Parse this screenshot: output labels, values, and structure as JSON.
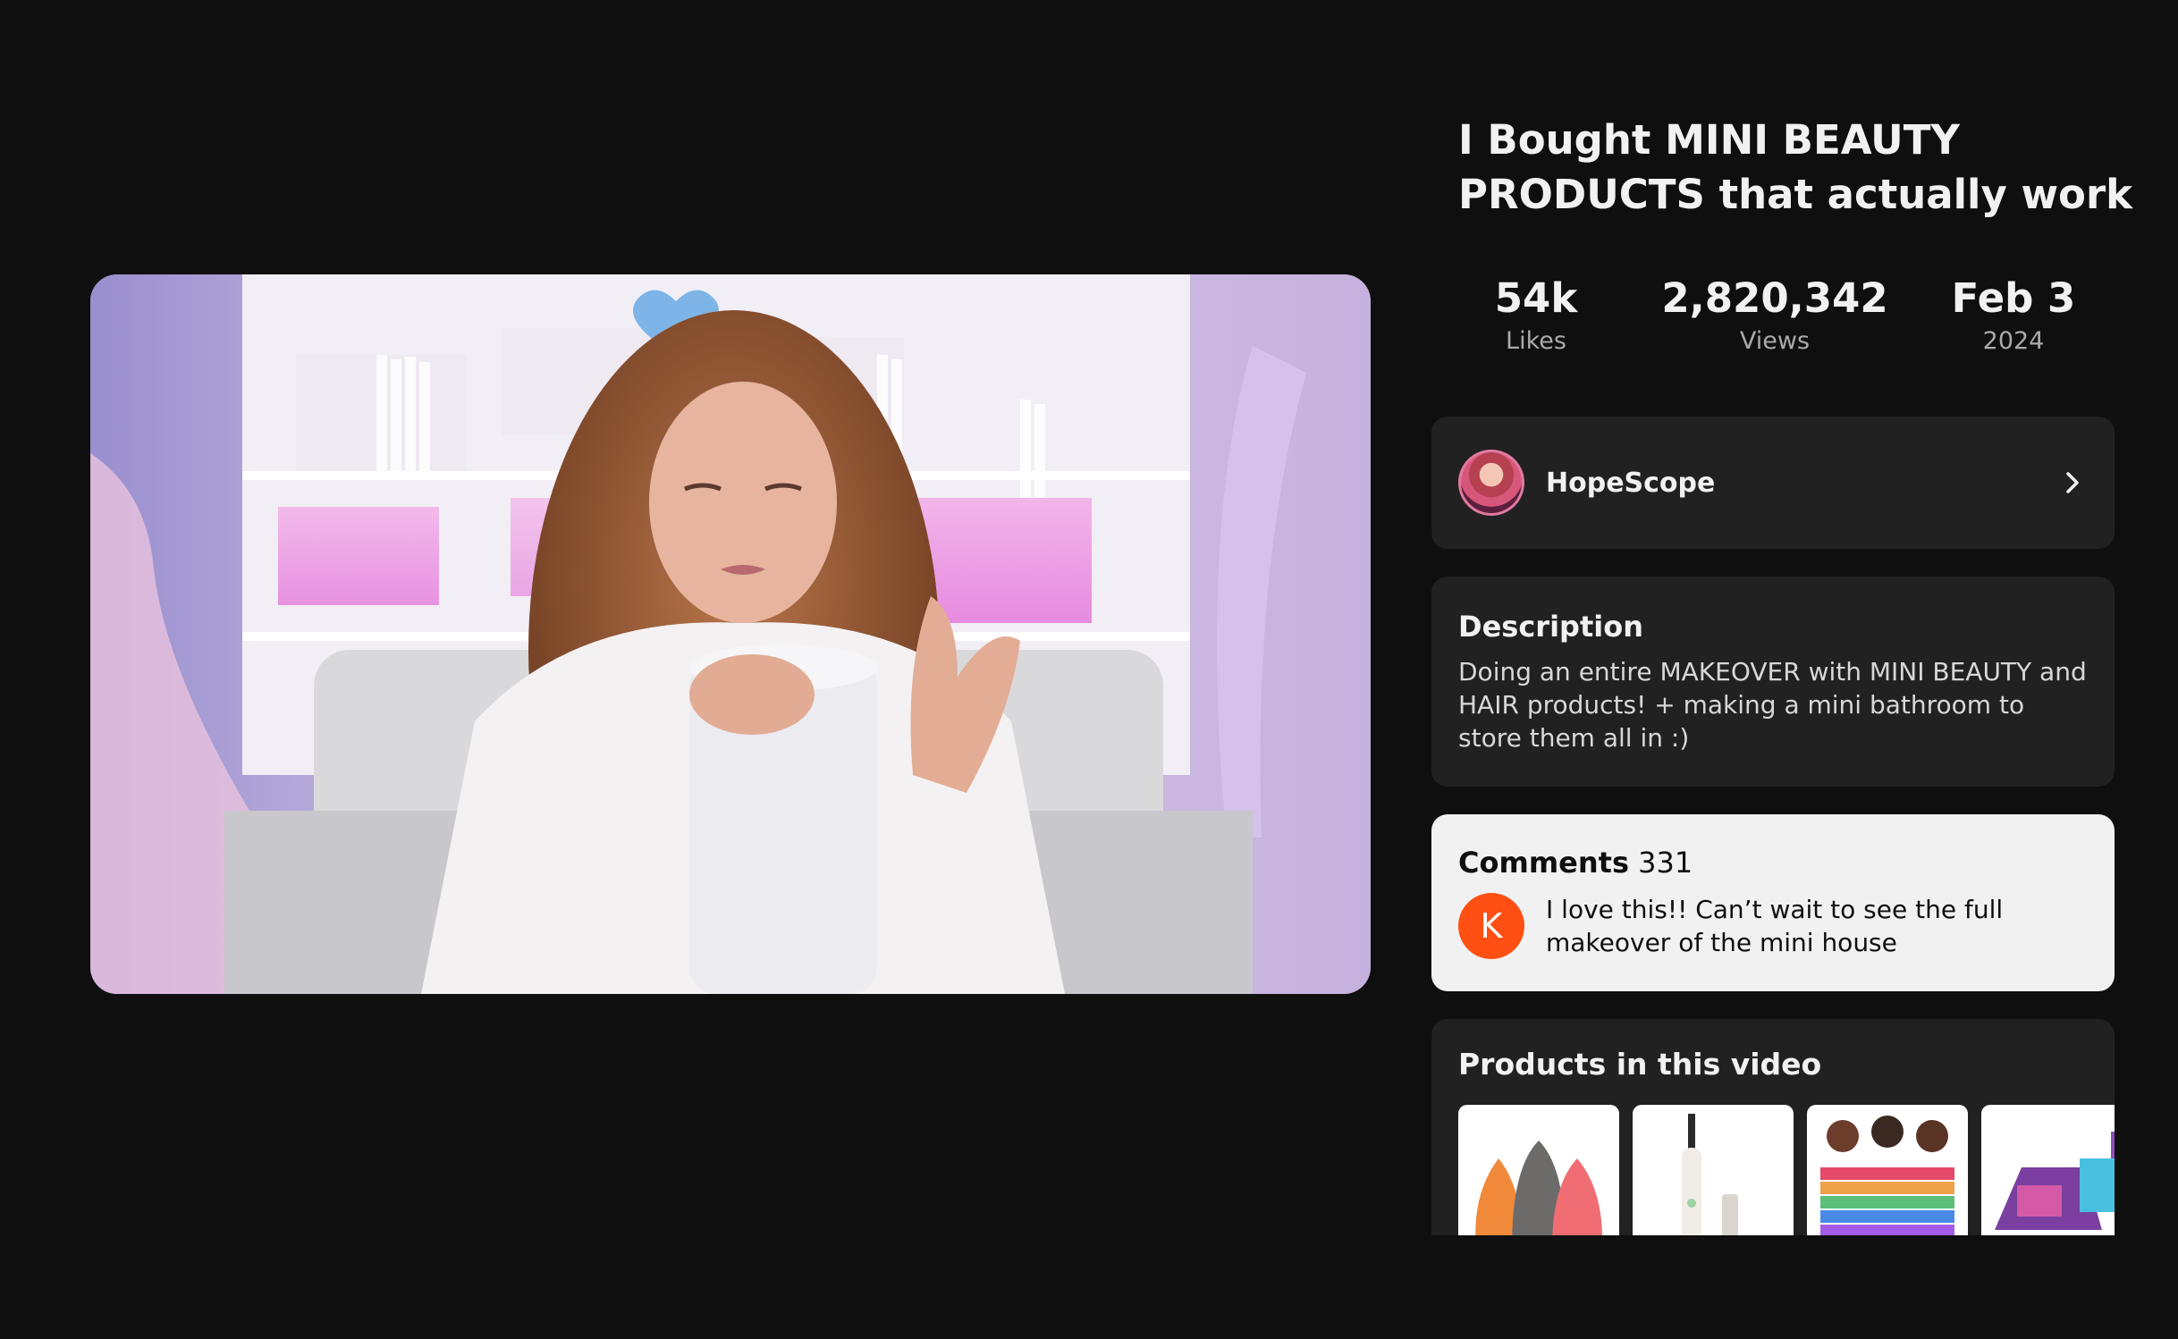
{
  "video": {
    "title": "I Bought MINI BEAUTY PRODUCTS that actually work",
    "stats": {
      "likes_value": "54k",
      "likes_label": "Likes",
      "views_value": "2,820,342",
      "views_label": "Views",
      "date_value": "Feb 3",
      "date_year": "2024"
    }
  },
  "channel": {
    "name": "HopeScope",
    "avatar_icon": "channel-avatar",
    "chevron_icon": "chevron-right-icon"
  },
  "description": {
    "heading": "Description",
    "text": "Doing an entire MAKEOVER with MINI BEAUTY and HAIR products! + making a mini bathroom to store them all in :)"
  },
  "comments": {
    "heading": "Comments",
    "count": "331",
    "top_comment": {
      "author_initial": "K",
      "text": "I love this!! Can’t wait to see the full makeover of the mini house",
      "avatar_color": "#ff4f13"
    }
  },
  "products": {
    "heading": "Products in this video",
    "items": [
      {
        "icon": "makeup-sponges-thumbnail"
      },
      {
        "icon": "electric-toothbrush-thumbnail"
      },
      {
        "icon": "hair-clips-thumbnail"
      },
      {
        "icon": "mini-makeup-kit-thumbnail"
      }
    ]
  },
  "colors": {
    "background": "#0f0f0f",
    "card": "#212121",
    "comments_card": "#f1f1f1",
    "secondary_text": "#aaaaaa"
  }
}
